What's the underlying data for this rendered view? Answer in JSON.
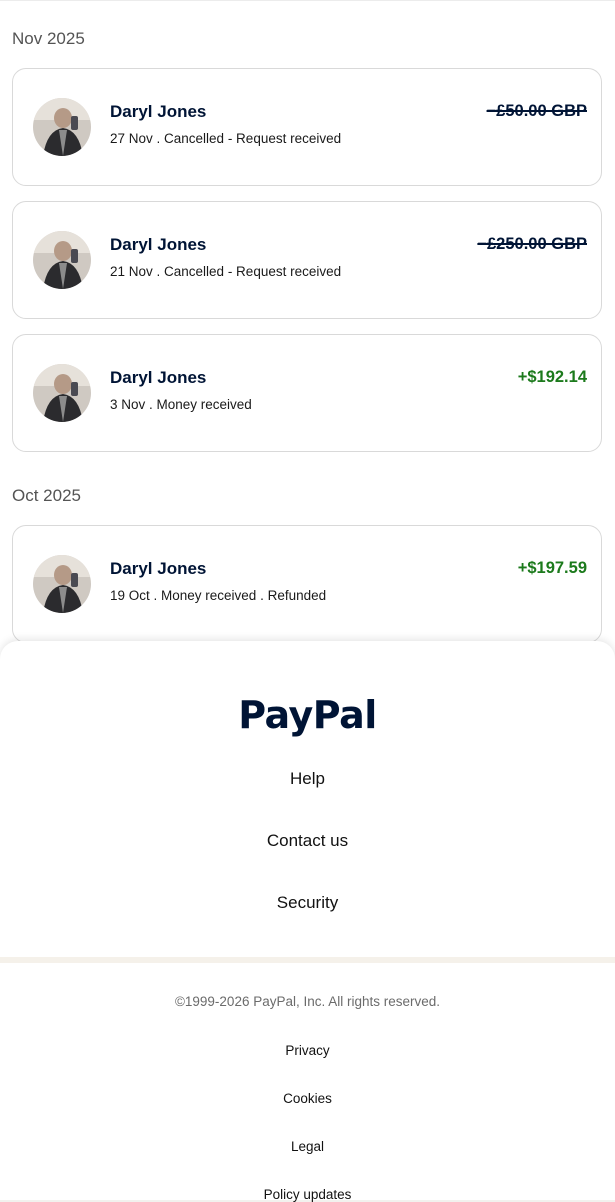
{
  "groups": [
    {
      "month": "Nov 2025",
      "transactions": [
        {
          "name": "Daryl Jones",
          "detail": "27 Nov . Cancelled - Request received",
          "amount": "−£50.00 GBP",
          "status": "cancelled"
        },
        {
          "name": "Daryl Jones",
          "detail": "21 Nov . Cancelled - Request received",
          "amount": "−£250.00 GBP",
          "status": "cancelled"
        },
        {
          "name": "Daryl Jones",
          "detail": "3 Nov . Money received",
          "amount": "+$192.14",
          "status": "received"
        }
      ]
    },
    {
      "month": "Oct 2025",
      "transactions": [
        {
          "name": "Daryl Jones",
          "detail": "19 Oct . Money received . Refunded",
          "amount": "+$197.59",
          "status": "received"
        }
      ]
    }
  ],
  "footer": {
    "logo": "PayPal",
    "links": [
      "Help",
      "Contact us",
      "Security"
    ]
  },
  "legal": {
    "copyright": "©1999-2026 PayPal, Inc. All rights reserved.",
    "links": [
      "Privacy",
      "Cookies",
      "Legal",
      "Policy updates"
    ]
  },
  "colors": {
    "positive": "#1c7a1c",
    "text_dark": "#001435"
  },
  "icons": {
    "avatar": "user-photo-avatar"
  }
}
